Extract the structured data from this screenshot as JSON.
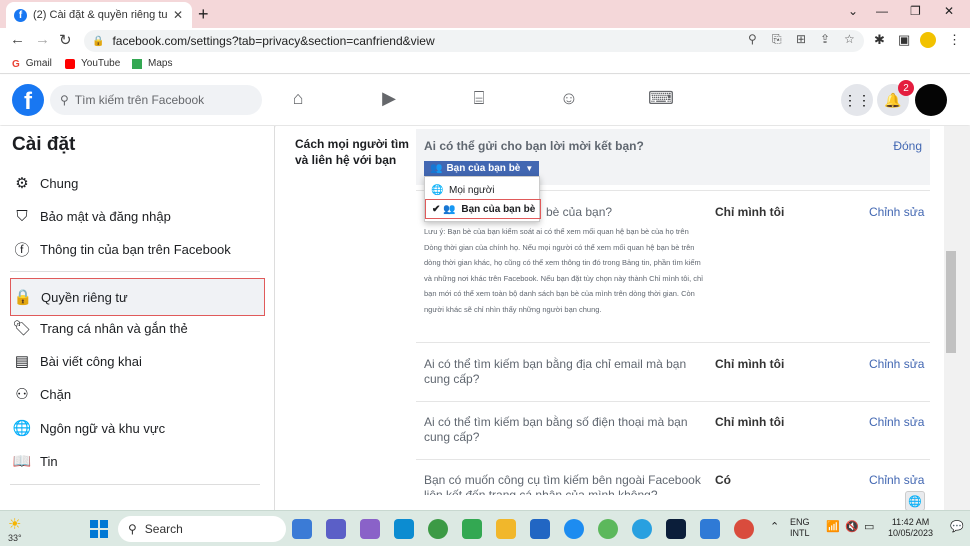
{
  "browser": {
    "tab_title": "(2) Cài đặt & quyền riêng tư | Fac",
    "url": "facebook.com/settings?tab=privacy&section=canfriend&view",
    "bookmarks": [
      "Gmail",
      "YouTube",
      "Maps"
    ]
  },
  "fb": {
    "search_placeholder": "Tìm kiếm trên Facebook",
    "notification_count": "2"
  },
  "sidebar": {
    "title": "Cài đặt",
    "items": [
      {
        "label": "Chung",
        "icon": "gear-icon"
      },
      {
        "label": "Bảo mật và đăng nhập",
        "icon": "shield-icon"
      },
      {
        "label": "Thông tin của bạn trên Facebook",
        "icon": "facebook-icon"
      },
      {
        "label": "Quyền riêng tư",
        "icon": "lock-icon"
      },
      {
        "label": "Trang cá nhân và gắn thẻ",
        "icon": "tag-icon"
      },
      {
        "label": "Bài viết công khai",
        "icon": "post-icon"
      },
      {
        "label": "Chặn",
        "icon": "block-user-icon"
      },
      {
        "label": "Ngôn ngữ và khu vực",
        "icon": "globe-icon"
      },
      {
        "label": "Tin",
        "icon": "book-icon"
      }
    ]
  },
  "main": {
    "section_label": "Cách mọi người tìm và liên hệ với bạn",
    "q_friend_request": "Ai có thể gửi cho bạn lời mời kết bạn?",
    "close_label": "Đóng",
    "dropdown_label": "Bạn của bạn bè",
    "dropdown_options": [
      "Mọi người",
      "Bạn của bạn bè"
    ],
    "q_friend_list": "Ai có thể xem danh sách bạn bè của bạn?",
    "q_friend_list_visible": "bè của bạn?",
    "note": "Lưu ý: Bạn bè của bạn kiểm soát ai có thể xem mối quan hệ bạn bè của họ trên Dòng thời gian của chính họ. Nếu mọi người có thể xem mối quan hệ bạn bè trên dòng thời gian khác, họ cũng có thể xem thông tin đó trong Bảng tin, phần tìm kiếm và những nơi khác trên Facebook. Nếu bạn đặt tùy chọn này thành Chỉ mình tôi, chỉ bạn mới có thể xem toàn bộ danh sách bạn bè của mình trên dòng thời gian. Còn người khác sẽ chỉ nhìn thấy những người bạn chung.",
    "rows": [
      {
        "question": "Ai có thể tìm kiếm bạn bằng địa chỉ email mà bạn cung cấp?",
        "value": "Chỉ mình tôi",
        "edit": "Chỉnh sửa"
      },
      {
        "question": "Ai có thể tìm kiếm bạn bằng số điện thoại mà bạn cung cấp?",
        "value": "Chỉ mình tôi",
        "edit": "Chỉnh sửa"
      },
      {
        "question": "Bạn có muốn công cụ tìm kiếm bên ngoài Facebook liên kết đến trang cá nhân của mình không?",
        "value": "Có",
        "edit": "Chỉnh sửa"
      }
    ],
    "friend_list_value": "Chỉ mình tôi",
    "friend_list_edit": "Chỉnh sửa"
  },
  "taskbar": {
    "temperature": "33°",
    "search_label": "Search",
    "lang_line1": "ENG",
    "lang_line2": "INTL",
    "time": "11:42 AM",
    "date": "10/05/2023"
  },
  "colors": {
    "fb_blue": "#1877f2",
    "link_blue": "#4267b2",
    "highlight_red": "#e05a5a"
  }
}
